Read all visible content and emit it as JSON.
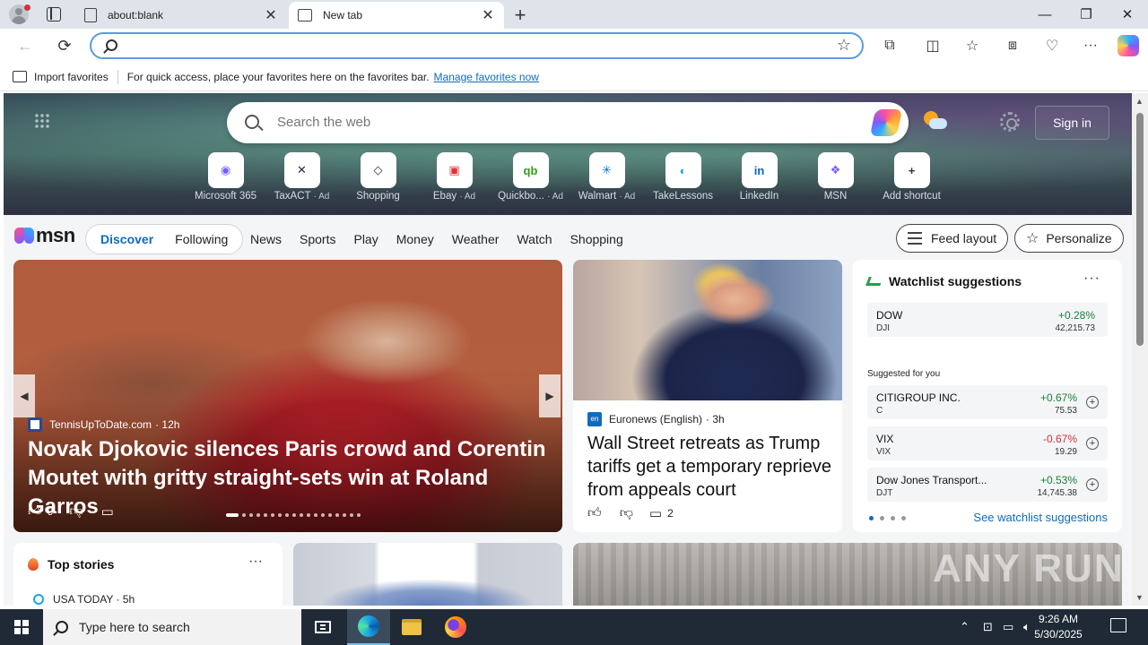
{
  "browser": {
    "tabs": [
      {
        "title": "about:blank",
        "close": "✕"
      },
      {
        "title": "New tab",
        "close": "✕"
      }
    ],
    "new_tab": "+",
    "window_controls": {
      "minimize": "—",
      "restore": "❐",
      "close": "✕"
    },
    "address": {
      "value": "",
      "placeholder": ""
    },
    "favorites_bar": {
      "import_label": "Import favorites",
      "hint": "For quick access, place your favorites here on the favorites bar.",
      "manage_link": "Manage favorites now"
    }
  },
  "hero": {
    "search_placeholder": "Search the web",
    "signin_label": "Sign in",
    "shortcuts": [
      {
        "label": "Microsoft 365",
        "ad": "",
        "glyph": "◉",
        "color": "#7a5cff"
      },
      {
        "label": "TaxACT",
        "ad": "· Ad",
        "glyph": "✕",
        "color": "#1b2b45"
      },
      {
        "label": "Shopping",
        "ad": "",
        "glyph": "◇",
        "color": "#333333"
      },
      {
        "label": "Ebay",
        "ad": "· Ad",
        "glyph": "▣",
        "color": "#e53238"
      },
      {
        "label": "Quickbo...",
        "ad": "· Ad",
        "glyph": "qb",
        "color": "#2ca01c"
      },
      {
        "label": "Walmart",
        "ad": "· Ad",
        "glyph": "✳",
        "color": "#0071ce"
      },
      {
        "label": "TakeLessons",
        "ad": "",
        "glyph": "◐",
        "color": "#1aa0d8"
      },
      {
        "label": "LinkedIn",
        "ad": "",
        "glyph": "in",
        "color": "#0a66c2"
      },
      {
        "label": "MSN",
        "ad": "",
        "glyph": "❖",
        "color": "#7a5cff"
      },
      {
        "label": "Add shortcut",
        "ad": "",
        "glyph": "+",
        "color": "#333333"
      }
    ]
  },
  "msn": {
    "logo_text": "msn",
    "pill_tabs": [
      "Discover",
      "Following"
    ],
    "nav_links": [
      "News",
      "Sports",
      "Play",
      "Money",
      "Weather",
      "Watch",
      "Shopping"
    ],
    "feed_layout_label": "Feed layout",
    "personalize_label": "Personalize"
  },
  "hero_story": {
    "source": "TennisUpToDate.com",
    "age": "· 12h",
    "headline": "Novak Djokovic silences Paris crowd and Corentin Moutet with gritty straight-sets win at Roland Garros",
    "likes": "9"
  },
  "news_story": {
    "source_badge": "en",
    "source": "Euronews (English)",
    "age": "· 3h",
    "headline": "Wall Street retreats as Trump tariffs get a temporary reprieve from appeals court",
    "comments": "2"
  },
  "watchlist": {
    "title": "Watchlist suggestions",
    "more": "···",
    "primary": {
      "name": "DOW",
      "symbol": "DJI",
      "change": "+0.28%",
      "price": "42,215.73",
      "direction": "up"
    },
    "suggested_label": "Suggested for you",
    "suggestions": [
      {
        "name": "CITIGROUP INC.",
        "symbol": "C",
        "change": "+0.67%",
        "price": "75.53",
        "direction": "up"
      },
      {
        "name": "VIX",
        "symbol": "VIX",
        "change": "-0.67%",
        "price": "19.29",
        "direction": "down"
      },
      {
        "name": "Dow Jones Transport...",
        "symbol": "DJT",
        "change": "+0.53%",
        "price": "14,745.38",
        "direction": "up"
      }
    ],
    "see_link": "See watchlist suggestions"
  },
  "top_stories": {
    "title": "Top stories",
    "more": "···",
    "first_source": "USA TODAY · 5h"
  },
  "watermark": "ANY RUN",
  "taskbar": {
    "search_placeholder": "Type here to search",
    "time": "9:26 AM",
    "date": "5/30/2025"
  }
}
